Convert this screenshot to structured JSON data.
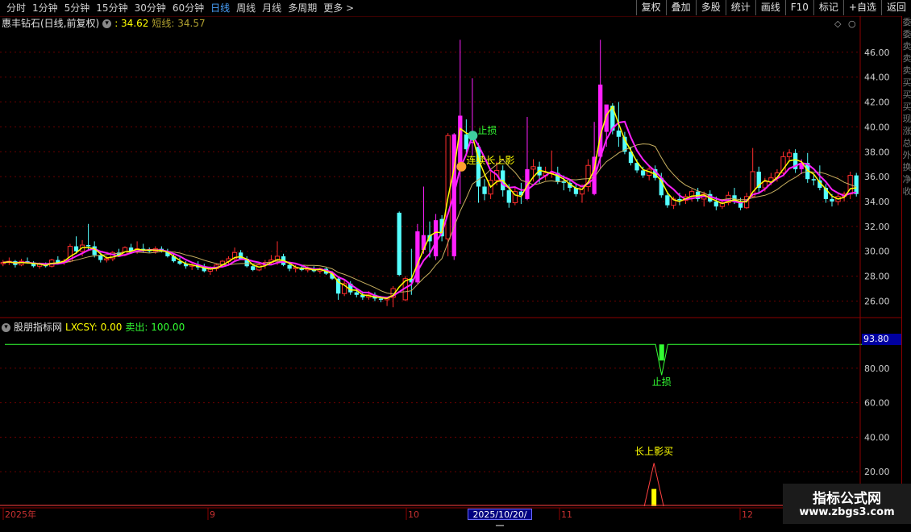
{
  "toolbar": {
    "periods": [
      {
        "label": "分时",
        "active": false
      },
      {
        "label": "1分钟",
        "active": false
      },
      {
        "label": "5分钟",
        "active": false
      },
      {
        "label": "15分钟",
        "active": false
      },
      {
        "label": "30分钟",
        "active": false
      },
      {
        "label": "60分钟",
        "active": false
      },
      {
        "label": "日线",
        "active": true
      },
      {
        "label": "周线",
        "active": false
      },
      {
        "label": "月线",
        "active": false
      },
      {
        "label": "多周期",
        "active": false
      },
      {
        "label": "更多 >",
        "active": false
      }
    ],
    "actions": [
      "复权",
      "叠加",
      "多股",
      "统计",
      "画线",
      "F10",
      "标记",
      "+自选",
      "返回"
    ]
  },
  "main_chart": {
    "stock_name": "惠丰钻石(日线,前复权)",
    "value_1": ": 34.62",
    "short_line_label": "短线: 34.57",
    "price_ticks": [
      "46.00",
      "44.00",
      "42.00",
      "40.00",
      "38.00",
      "36.00",
      "34.00",
      "32.00",
      "30.00",
      "28.00",
      "26.00"
    ],
    "annotations": {
      "stop_loss": "止损",
      "long_shadow": "连续长上影"
    }
  },
  "indicator": {
    "name": "股朋指标网",
    "lxcsy": "LXCSY: 0.00",
    "sell": "卖出: 100.00",
    "current_value": "93.80",
    "ticks": [
      "80.00",
      "60.00",
      "40.00",
      "20.00"
    ],
    "stop_label": "止损",
    "buy_label": "长上影买"
  },
  "axis": {
    "labels": [
      "2025年",
      "9",
      "10",
      "11",
      "12"
    ],
    "cursor_date": "2025/10/20/一"
  },
  "right_edge_chars": [
    "委",
    "委",
    "卖",
    "卖",
    "卖",
    "买",
    "买",
    "买",
    "现",
    "涨",
    "总",
    "外",
    "换",
    "净",
    "收"
  ],
  "watermark": {
    "title": "指标公式网",
    "url": "www.zbgs3.com"
  },
  "colors": {
    "up": "#ff2d2d",
    "down": "#54ffff",
    "magenta": "#ff20ff",
    "yellow": "#ffff00",
    "grid": "#6a0000",
    "axis": "#8b0000"
  },
  "chart_data": {
    "type": "candlestick",
    "candles": [
      [
        29.0,
        29.3,
        28.8,
        29.1
      ],
      [
        29.1,
        29.5,
        28.9,
        29.2
      ],
      [
        29.2,
        29.3,
        28.7,
        28.9
      ],
      [
        28.9,
        29.4,
        28.8,
        29.2
      ],
      [
        29.2,
        29.5,
        29.0,
        29.1
      ],
      [
        29.1,
        29.2,
        28.7,
        28.8
      ],
      [
        28.8,
        29.1,
        28.6,
        29.0
      ],
      [
        29.0,
        29.1,
        28.7,
        28.8
      ],
      [
        28.8,
        29.4,
        28.7,
        29.3
      ],
      [
        29.3,
        29.6,
        29.0,
        29.1
      ],
      [
        29.1,
        29.4,
        28.9,
        29.2
      ],
      [
        29.2,
        30.6,
        29.1,
        30.4
      ],
      [
        30.4,
        31.2,
        29.8,
        30.0
      ],
      [
        30.0,
        30.9,
        29.6,
        30.5
      ],
      [
        30.5,
        32.2,
        30.1,
        30.4
      ],
      [
        30.4,
        30.8,
        29.5,
        29.7
      ],
      [
        29.7,
        29.9,
        29.1,
        29.3
      ],
      [
        29.3,
        29.6,
        29.1,
        29.4
      ],
      [
        29.4,
        30.0,
        29.2,
        29.9
      ],
      [
        29.9,
        30.2,
        29.6,
        29.7
      ],
      [
        29.7,
        30.4,
        29.6,
        30.3
      ],
      [
        30.3,
        30.6,
        29.9,
        30.0
      ],
      [
        30.0,
        30.8,
        29.8,
        30.2
      ],
      [
        30.2,
        30.6,
        29.9,
        30.1
      ],
      [
        30.1,
        30.3,
        29.9,
        30.0
      ],
      [
        30.0,
        30.4,
        29.8,
        30.2
      ],
      [
        30.2,
        30.4,
        29.9,
        30.0
      ],
      [
        30.0,
        30.2,
        29.5,
        29.6
      ],
      [
        29.6,
        29.8,
        29.1,
        29.2
      ],
      [
        29.2,
        29.5,
        28.9,
        29.0
      ],
      [
        29.0,
        29.2,
        28.6,
        28.8
      ],
      [
        28.8,
        29.1,
        28.5,
        28.9
      ],
      [
        28.9,
        29.2,
        28.5,
        28.7
      ],
      [
        28.7,
        29.0,
        28.3,
        28.4
      ],
      [
        28.4,
        28.8,
        28.1,
        28.6
      ],
      [
        28.6,
        29.0,
        28.4,
        28.9
      ],
      [
        28.9,
        29.3,
        28.7,
        29.2
      ],
      [
        29.2,
        29.6,
        28.9,
        29.4
      ],
      [
        29.4,
        30.3,
        29.2,
        29.9
      ],
      [
        29.9,
        30.1,
        29.3,
        29.4
      ],
      [
        29.4,
        29.6,
        28.7,
        28.8
      ],
      [
        28.8,
        29.0,
        28.4,
        28.5
      ],
      [
        28.5,
        29.1,
        28.4,
        28.9
      ],
      [
        28.9,
        29.3,
        28.6,
        29.1
      ],
      [
        29.1,
        29.7,
        28.9,
        29.3
      ],
      [
        29.3,
        30.8,
        28.9,
        29.6
      ],
      [
        29.6,
        29.8,
        28.8,
        28.9
      ],
      [
        28.9,
        29.0,
        28.4,
        28.6
      ],
      [
        28.6,
        28.9,
        28.3,
        28.7
      ],
      [
        28.7,
        28.9,
        28.4,
        28.5
      ],
      [
        28.5,
        28.8,
        28.3,
        28.6
      ],
      [
        28.6,
        28.8,
        28.3,
        28.4
      ],
      [
        28.4,
        28.7,
        28.2,
        28.6
      ],
      [
        28.6,
        28.7,
        28.1,
        28.2
      ],
      [
        28.2,
        28.4,
        27.7,
        27.8
      ],
      [
        27.8,
        28.0,
        26.1,
        26.6
      ],
      [
        26.6,
        27.7,
        26.4,
        27.4
      ],
      [
        27.4,
        27.6,
        26.5,
        26.7
      ],
      [
        26.7,
        27.0,
        26.3,
        26.5
      ],
      [
        26.5,
        26.7,
        26.1,
        26.3
      ],
      [
        26.3,
        26.8,
        26.1,
        26.5
      ],
      [
        26.5,
        26.7,
        26.0,
        26.2
      ],
      [
        26.2,
        26.4,
        25.9,
        26.1
      ],
      [
        26.1,
        26.3,
        25.6,
        26.3
      ],
      [
        26.3,
        27.2,
        25.5,
        27.0
      ],
      [
        33.1,
        33.2,
        28.0,
        28.1
      ],
      [
        26.1,
        28.0,
        26.0,
        27.8
      ],
      [
        27.8,
        30.2,
        26.5,
        27.5
      ],
      [
        27.5,
        32.2,
        27.4,
        31.6
      ],
      [
        30.1,
        35.2,
        29.8,
        31.3
      ],
      [
        31.3,
        32.4,
        29.5,
        30.8
      ],
      [
        29.6,
        33.0,
        29.3,
        32.5
      ],
      [
        32.6,
        32.9,
        30.8,
        31.2
      ],
      [
        31.0,
        39.5,
        29.6,
        39.3
      ],
      [
        29.6,
        39.5,
        29.3,
        39.4
      ],
      [
        37.1,
        47.0,
        33.8,
        40.9
      ],
      [
        39.4,
        40.6,
        37.7,
        38.2
      ],
      [
        38.7,
        43.9,
        37.7,
        38.8
      ],
      [
        38.4,
        38.7,
        33.9,
        35.2
      ],
      [
        35.2,
        35.8,
        34.1,
        34.6
      ],
      [
        34.6,
        36.4,
        34.2,
        35.7
      ],
      [
        35.7,
        37.2,
        35.3,
        36.5
      ],
      [
        36.5,
        36.9,
        34.4,
        34.9
      ],
      [
        34.9,
        35.4,
        33.5,
        33.9
      ],
      [
        33.9,
        35.1,
        33.7,
        34.8
      ],
      [
        34.8,
        35.5,
        33.8,
        34.5
      ],
      [
        34.2,
        40.8,
        34.1,
        36.6
      ],
      [
        36.6,
        37.4,
        35.6,
        36.8
      ],
      [
        36.8,
        37.2,
        35.5,
        36.1
      ],
      [
        36.1,
        36.8,
        35.7,
        36.3
      ],
      [
        36.3,
        38.1,
        35.9,
        36.3
      ],
      [
        36.3,
        36.8,
        35.4,
        35.6
      ],
      [
        35.6,
        36.1,
        34.9,
        35.5
      ],
      [
        35.5,
        35.7,
        34.8,
        35.1
      ],
      [
        35.1,
        35.4,
        34.4,
        34.6
      ],
      [
        34.6,
        35.4,
        33.9,
        35.2
      ],
      [
        35.2,
        37.4,
        34.8,
        36.9
      ],
      [
        34.6,
        40.4,
        34.5,
        37.6
      ],
      [
        37.6,
        47.0,
        36.6,
        43.4
      ],
      [
        39.6,
        41.2,
        38.4,
        41.8
      ],
      [
        41.7,
        41.9,
        39.4,
        39.7
      ],
      [
        39.7,
        42.0,
        38.4,
        39.2
      ],
      [
        39.2,
        39.6,
        37.8,
        38.0
      ],
      [
        38.0,
        38.4,
        36.9,
        37.1
      ],
      [
        37.1,
        37.4,
        36.3,
        36.5
      ],
      [
        36.5,
        36.8,
        35.9,
        36.1
      ],
      [
        36.1,
        36.9,
        35.7,
        36.6
      ],
      [
        36.6,
        36.9,
        35.7,
        35.9
      ],
      [
        35.9,
        36.3,
        34.3,
        34.5
      ],
      [
        34.5,
        34.8,
        33.5,
        33.7
      ],
      [
        33.7,
        34.4,
        33.4,
        34.2
      ],
      [
        34.2,
        34.7,
        33.7,
        34.1
      ],
      [
        34.1,
        34.6,
        33.8,
        34.4
      ],
      [
        34.4,
        35.0,
        34.0,
        34.8
      ],
      [
        34.8,
        35.1,
        34.0,
        34.2
      ],
      [
        34.2,
        34.8,
        33.6,
        34.6
      ],
      [
        34.6,
        34.9,
        33.9,
        34.0
      ],
      [
        34.0,
        34.4,
        33.3,
        33.6
      ],
      [
        33.6,
        34.1,
        33.4,
        33.9
      ],
      [
        33.9,
        34.8,
        33.7,
        34.5
      ],
      [
        34.5,
        35.1,
        33.8,
        34.0
      ],
      [
        34.0,
        34.3,
        33.3,
        33.5
      ],
      [
        33.5,
        34.7,
        33.4,
        34.4
      ],
      [
        34.4,
        38.3,
        34.3,
        36.4
      ],
      [
        36.4,
        36.8,
        34.7,
        35.1
      ],
      [
        35.1,
        35.9,
        34.8,
        35.6
      ],
      [
        35.6,
        36.3,
        35.3,
        35.9
      ],
      [
        35.9,
        36.6,
        35.6,
        36.3
      ],
      [
        36.3,
        38.0,
        36.1,
        37.6
      ],
      [
        37.6,
        38.2,
        37.2,
        37.9
      ],
      [
        37.9,
        38.2,
        36.3,
        36.6
      ],
      [
        36.6,
        37.4,
        36.2,
        37.1
      ],
      [
        37.1,
        37.9,
        35.5,
        35.8
      ],
      [
        35.8,
        36.2,
        35.3,
        35.7
      ],
      [
        35.7,
        36.9,
        34.9,
        35.1
      ],
      [
        35.1,
        35.4,
        33.9,
        34.2
      ],
      [
        34.2,
        34.6,
        33.6,
        34.0
      ],
      [
        34.0,
        34.6,
        33.7,
        34.4
      ],
      [
        34.4,
        34.8,
        34.0,
        34.6
      ],
      [
        34.6,
        36.4,
        34.2,
        36.1
      ],
      [
        36.1,
        36.3,
        34.4,
        34.6
      ]
    ],
    "indicator_line": [
      [
        0,
        93.8
      ],
      [
        102,
        93.8
      ],
      [
        104,
        93.8
      ],
      [
        106,
        93.8
      ],
      [
        107,
        76.0
      ],
      [
        108,
        93.8
      ],
      [
        110,
        93.8
      ],
      [
        112,
        93.8
      ],
      [
        140,
        93.8
      ]
    ],
    "buy_signal_index": 106
  }
}
